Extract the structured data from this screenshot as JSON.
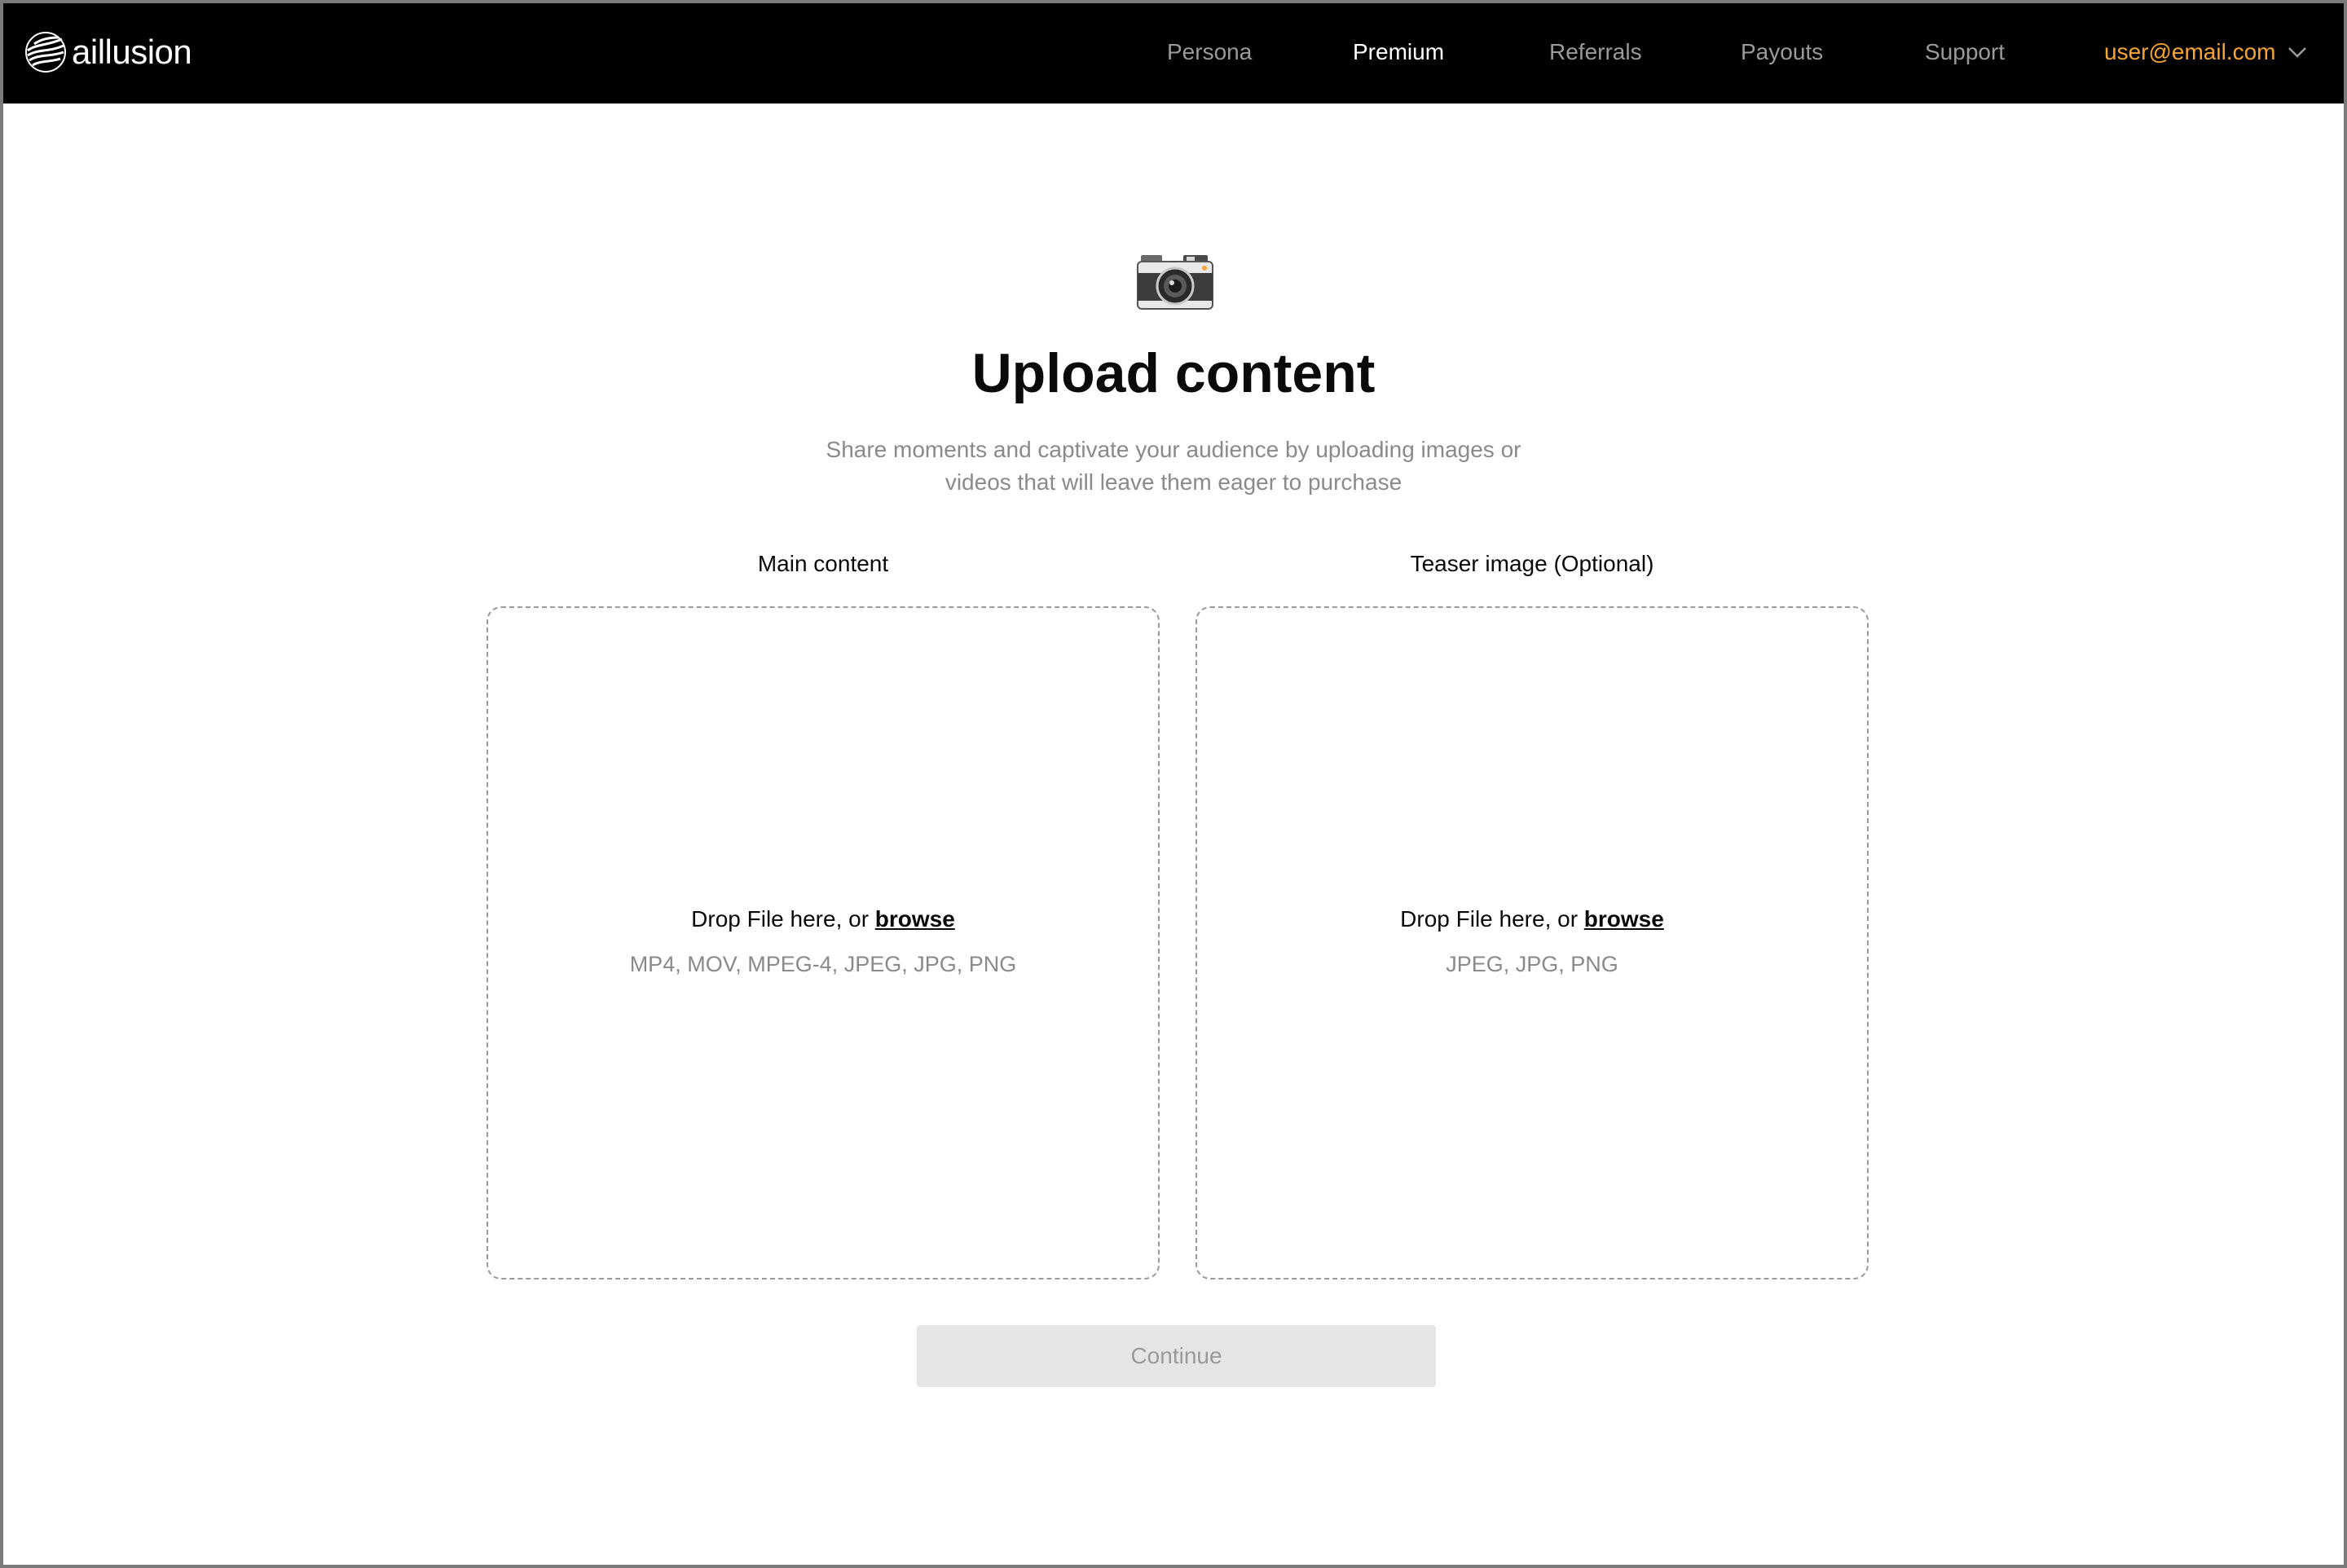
{
  "brand": {
    "name": "aillusion",
    "logo_icon": "aillusion-logo-icon"
  },
  "nav": {
    "items": [
      {
        "label": "Persona",
        "active": false
      },
      {
        "label": "Premium",
        "active": true
      },
      {
        "label": "Referrals",
        "active": false
      },
      {
        "label": "Payouts",
        "active": false
      },
      {
        "label": "Support",
        "active": false
      }
    ],
    "user_email": "user@email.com",
    "user_menu_icon": "chevron-down-icon"
  },
  "header": {
    "icon": "camera-icon",
    "title": "Upload content",
    "subtitle_line1": "Share moments and captivate your audience by uploading images or",
    "subtitle_line2": "videos that will leave them eager to purchase"
  },
  "upload": {
    "main": {
      "label": "Main content",
      "drop_text": "Drop File here, or ",
      "browse": "browse",
      "formats": "MP4, MOV, MPEG-4, JPEG, JPG, PNG"
    },
    "teaser": {
      "label": "Teaser image (Optional)",
      "drop_text": "Drop File here, or ",
      "browse": "browse",
      "formats": "JPEG, JPG, PNG"
    }
  },
  "actions": {
    "continue_label": "Continue",
    "continue_enabled": false
  },
  "colors": {
    "navbar_bg": "#000000",
    "accent": "#f5a534",
    "nav_inactive": "#9a9a9a",
    "button_disabled_bg": "#e5e5e5"
  }
}
